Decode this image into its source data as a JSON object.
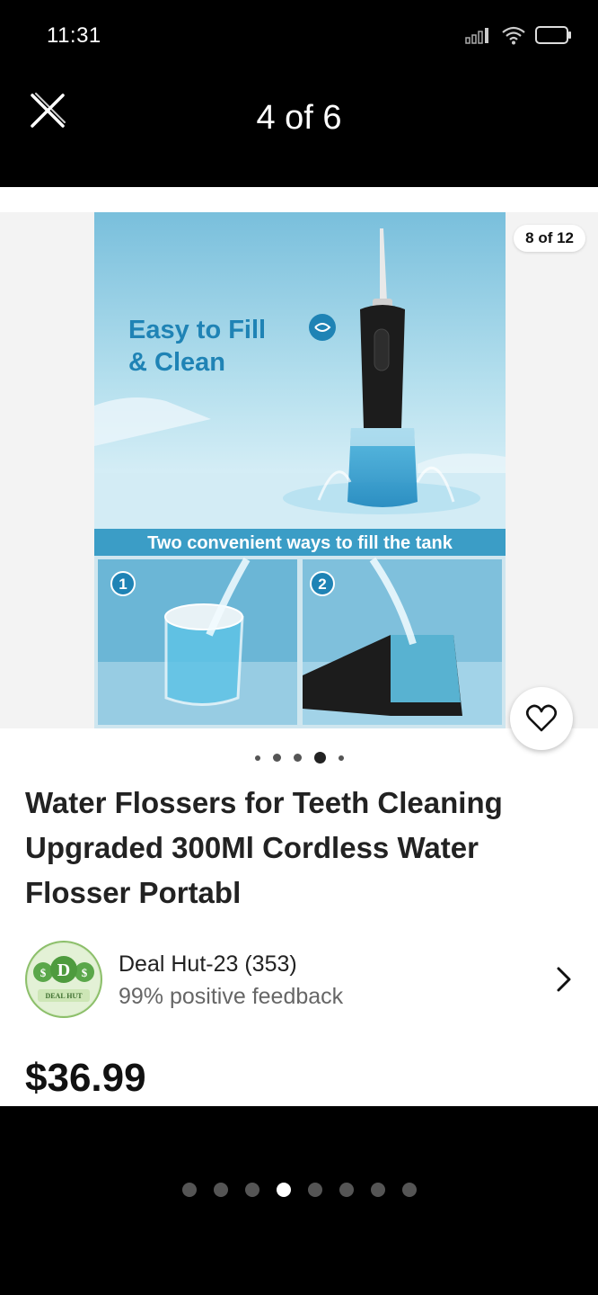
{
  "status": {
    "time": "11:31"
  },
  "viewer": {
    "page_indicator": "4 of 6"
  },
  "product_image": {
    "badge": "8 of 12",
    "headline_line1": "Easy to Fill",
    "headline_line2": "& Clean",
    "banner": "Two convenient ways to fill the tank",
    "step1": "1",
    "step2": "2"
  },
  "card_dots": {
    "count": 5,
    "active_index": 3
  },
  "listing": {
    "title": "Water Flossers for Teeth Cleaning Upgraded 300Ml Cordless Water Flosser Portabl",
    "price": "$36.99"
  },
  "seller": {
    "name": "Deal Hut-23 (353)",
    "feedback": "99% positive feedback",
    "logo_text": "DEAL HUT"
  },
  "bottom_dots": {
    "count": 8,
    "active_index": 3
  },
  "colors": {
    "background": "#000000",
    "card": "#ffffff",
    "image_blue": "#8ccbe0",
    "banner_blue": "#3b9dc6"
  }
}
